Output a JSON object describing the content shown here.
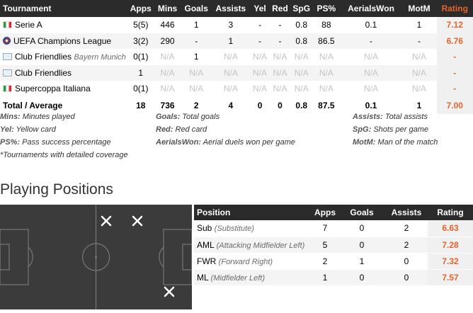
{
  "tournament_table": {
    "headers": [
      "Tournament",
      "Apps",
      "Mins",
      "Goals",
      "Assists",
      "Yel",
      "Red",
      "SpG",
      "PS%",
      "AerialsWon",
      "MotM",
      "Rating"
    ],
    "rows": [
      {
        "flag": "italy-flag-icon",
        "name": "Serie A",
        "note": "",
        "apps": "5(5)",
        "mins": "446",
        "goals": "1",
        "assists": "3",
        "yel": "-",
        "red": "-",
        "spg": "0.8",
        "ps": "88",
        "aerials": "0.1",
        "motm": "1",
        "rating": "7.12"
      },
      {
        "flag": "champions-league-icon",
        "name": "UEFA Champions League",
        "note": "",
        "apps": "3(2)",
        "mins": "290",
        "goals": "-",
        "assists": "1",
        "yel": "-",
        "red": "-",
        "spg": "0.8",
        "ps": "86.5",
        "aerials": "-",
        "motm": "-",
        "rating": "6.76"
      },
      {
        "flag": "fifa-icon",
        "name": "Club Friendlies",
        "note": "Bayern Munich",
        "apps": "0(1)",
        "mins": "N/A",
        "goals": "1",
        "assists": "N/A",
        "yel": "N/A",
        "red": "N/A",
        "spg": "N/A",
        "ps": "N/A",
        "aerials": "N/A",
        "motm": "N/A",
        "rating": "-"
      },
      {
        "flag": "fifa-icon",
        "name": "Club Friendlies",
        "note": "",
        "apps": "1",
        "mins": "N/A",
        "goals": "N/A",
        "assists": "N/A",
        "yel": "N/A",
        "red": "N/A",
        "spg": "N/A",
        "ps": "N/A",
        "aerials": "N/A",
        "motm": "N/A",
        "rating": "-"
      },
      {
        "flag": "italy-flag-icon",
        "name": "Supercoppa Italiana",
        "note": "",
        "apps": "0(1)",
        "mins": "N/A",
        "goals": "N/A",
        "assists": "N/A",
        "yel": "N/A",
        "red": "N/A",
        "spg": "N/A",
        "ps": "N/A",
        "aerials": "N/A",
        "motm": "N/A",
        "rating": "-"
      }
    ],
    "total": {
      "label": "Total / Average",
      "apps": "18",
      "mins": "736",
      "goals": "2",
      "assists": "4",
      "yel": "0",
      "red": "0",
      "spg": "0.8",
      "ps": "87.5",
      "aerials": "0.1",
      "motm": "1",
      "rating": "7.00"
    }
  },
  "legend": {
    "mins": {
      "key": "Mins:",
      "text": " Minutes played"
    },
    "goals": {
      "key": "Goals:",
      "text": " Total goals"
    },
    "assists": {
      "key": "Assists:",
      "text": " Total assists"
    },
    "yel": {
      "key": "Yel:",
      "text": " Yellow card"
    },
    "red": {
      "key": "Red:",
      "text": " Red card"
    },
    "spg": {
      "key": "SpG:",
      "text": " Shots per game"
    },
    "ps": {
      "key": "PS%:",
      "text": " Pass success percentage"
    },
    "aerials": {
      "key": "AerialsWon:",
      "text": " Aerial duels won per game"
    },
    "motm": {
      "key": "MotM:",
      "text": " Man of the match"
    },
    "coverage": "*Tournaments with detailed coverage"
  },
  "playing_positions": {
    "title": "Playing Positions",
    "headers": [
      "Position",
      "Apps",
      "Goals",
      "Assists",
      "Rating"
    ],
    "rows": [
      {
        "code": "Sub",
        "desc": "(Substitute)",
        "apps": "7",
        "goals": "0",
        "assists": "2",
        "rating": "6.63"
      },
      {
        "code": "AML",
        "desc": "(Attacking Midfielder Left)",
        "apps": "5",
        "goals": "0",
        "assists": "2",
        "rating": "7.28"
      },
      {
        "code": "FWR",
        "desc": "(Forward Right)",
        "apps": "2",
        "goals": "1",
        "assists": "0",
        "rating": "7.32"
      },
      {
        "code": "ML",
        "desc": "(Midfielder Left)",
        "apps": "1",
        "goals": "0",
        "assists": "0",
        "rating": "7.57"
      }
    ],
    "pitch_markers": "✕"
  },
  "colors": {
    "accent": "#e8632c",
    "header_bg": "#2b2b2b",
    "pitch_bg": "#3b3b3b"
  }
}
